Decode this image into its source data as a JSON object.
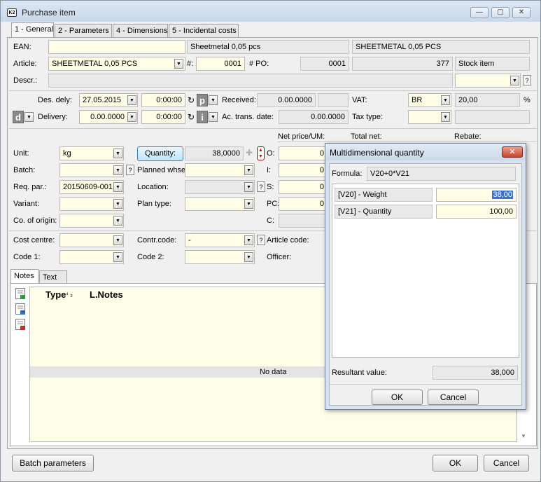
{
  "window": {
    "title": "Purchase item",
    "app_badge": "K2"
  },
  "tabs": [
    "1 - General",
    "2 - Parameters",
    "4 - Dimensions",
    "5 - Incidental costs"
  ],
  "row_ean": {
    "label": "EAN:",
    "value": "",
    "name": "Sheetmetal 0,05 pcs",
    "name2": "SHEETMETAL 0,05 PCS"
  },
  "row_article": {
    "label": "Article:",
    "value": "SHEETMETAL 0,05 PCS",
    "hash_label": "#:",
    "hash_value": "0001",
    "po_label": "# PO:",
    "po_value": "0001",
    "num": "377",
    "type": "Stock item"
  },
  "row_descr": {
    "label": "Descr.:"
  },
  "dates": {
    "des_dely_label": "Des. dely:",
    "des_dely_date": "27.05.2015",
    "des_dely_time": "0:00:00",
    "delivery_label": "Delivery:",
    "delivery_date": "0.00.0000",
    "delivery_time": "0:00:00",
    "received_label": "Received:",
    "received_value": "0.00.0000",
    "ac_trans_label": "Ac. trans. date:",
    "ac_trans_value": "0.00.0000",
    "vat_label": "VAT:",
    "vat_code": "BR",
    "vat_rate": "20,00",
    "vat_unit": "%",
    "tax_type_label": "Tax type:",
    "p_btn": "p",
    "i_btn": "i",
    "d_btn": "d"
  },
  "price_headers": {
    "net_price": "Net price/UM:",
    "total_net": "Total net:",
    "rebate": "Rebate:"
  },
  "left_fields": {
    "unit_label": "Unit:",
    "unit_value": "kg",
    "batch_label": "Batch:",
    "req_par_label": "Req. par.:",
    "req_par_value": "20150609-001",
    "variant_label": "Variant:",
    "co_origin_label": "Co. of origin:"
  },
  "mid_fields": {
    "quantity_btn": "Quantity:",
    "quantity_value": "38,0000",
    "planned_whse_label": "Planned whse",
    "location_label": "Location:",
    "plan_type_label": "Plan type:"
  },
  "price_rows": {
    "o": "O:",
    "i": "I:",
    "s": "S:",
    "pc": "PC:",
    "c": "C:",
    "zero": "0"
  },
  "codes": {
    "cost_centre_label": "Cost centre:",
    "contr_code_label": "Contr.code:",
    "contr_code_value": "-",
    "article_code_label": "Article code:",
    "code1_label": "Code 1:",
    "code2_label": "Code 2:",
    "officer_label": "Officer:"
  },
  "notes_tabs": [
    "Notes",
    "Text"
  ],
  "notes_table": {
    "col_type": "Type",
    "col_sort": "⁴ ₂",
    "col_lnotes": "L.Notes",
    "empty": "No data"
  },
  "bottom": {
    "batch_params": "Batch parameters",
    "ok": "OK",
    "cancel": "Cancel"
  },
  "dialog": {
    "title": "Multidimensional quantity",
    "formula_label": "Formula:",
    "formula_value": "V20+0*V21",
    "rows": [
      {
        "label": "[V20] - Weight",
        "value": "38,00"
      },
      {
        "label": "[V21] - Quantity",
        "value": "100,00"
      }
    ],
    "result_label": "Resultant value:",
    "result_value": "38,000",
    "ok": "OK",
    "cancel": "Cancel"
  },
  "symbols": {
    "help": "?",
    "dropdown": "▼",
    "refresh": "↻",
    "plus": "✚",
    "close": "✕",
    "minimize": "—",
    "maximize": "▢",
    "scroll_down": "▼"
  }
}
